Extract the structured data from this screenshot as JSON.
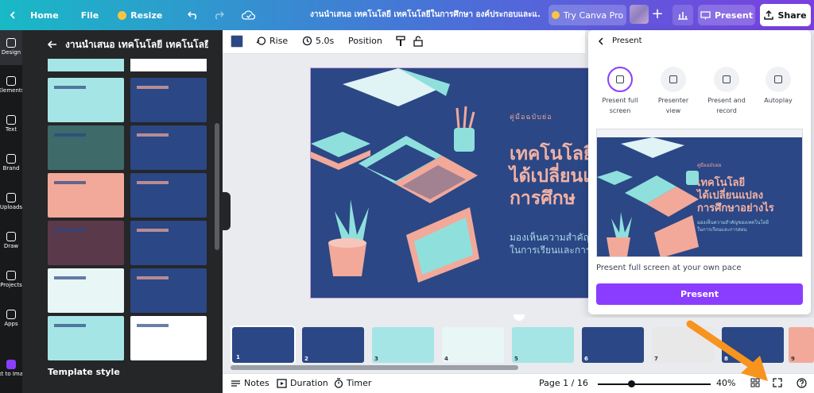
{
  "header": {
    "home_label": "Home",
    "file_label": "File",
    "resize_label": "Resize",
    "doc_title": "งานนำเสนอ เทคโนโลยี เทคโนโลยีในการศึกษา องค์ประกอบและแ...",
    "try_pro_label": "Try Canva Pro",
    "present_label": "Present",
    "share_label": "Share"
  },
  "rail": [
    {
      "label": "Design",
      "icon": "design-icon"
    },
    {
      "label": "Elements",
      "icon": "elements-icon"
    },
    {
      "label": "Text",
      "icon": "text-icon"
    },
    {
      "label": "Brand",
      "icon": "brand-icon"
    },
    {
      "label": "Uploads",
      "icon": "uploads-icon"
    },
    {
      "label": "Draw",
      "icon": "draw-icon"
    },
    {
      "label": "Projects",
      "icon": "projects-icon"
    },
    {
      "label": "Apps",
      "icon": "apps-icon"
    },
    {
      "label": "Text to Image",
      "icon": "text-to-image-icon"
    }
  ],
  "panel": {
    "title": "งานนำเสนอ เทคโนโลยี เทคโนโลยี",
    "template_style_label": "Template style"
  },
  "toolbar": {
    "color": "#2b4785",
    "rise_label": "Rise",
    "duration_label": "5.0s",
    "position_label": "Position"
  },
  "slide": {
    "subtitle": "คู่มือฉบับย่อ",
    "heading_lines": [
      "เทคโนโลยี",
      "ได้เปลี่ยนแ",
      "การศึกษ"
    ],
    "body_lines": [
      "มองเห็นความสำคัญ",
      "ในการเรียนและการส"
    ]
  },
  "present_panel": {
    "back_label": "Present",
    "options": [
      {
        "label": "Present full screen",
        "icon": "fullscreen-icon",
        "selected": true
      },
      {
        "label": "Presenter view",
        "icon": "presenter-view-icon",
        "selected": false
      },
      {
        "label": "Present and record",
        "icon": "record-icon",
        "selected": false
      },
      {
        "label": "Autoplay",
        "icon": "play-icon",
        "selected": false
      }
    ],
    "preview": {
      "subtitle": "คู่มือฉบับย่อ",
      "heading_lines": [
        "เทคโนโลยี",
        "ได้เปลี่ยนแปลง",
        "การศึกษาอย่างไร"
      ],
      "body_lines": [
        "มองเห็นความสำคัญของเทคโนโลยี",
        "ในการเรียนและการสอน"
      ]
    },
    "caption": "Present full screen at your own pace",
    "present_button": "Present"
  },
  "filmstrip": {
    "pages": [
      "1",
      "2",
      "3",
      "4",
      "5",
      "6",
      "7",
      "8",
      "9"
    ]
  },
  "bottom": {
    "notes_label": "Notes",
    "duration_label": "Duration",
    "timer_label": "Timer",
    "page_label": "Page 1 / 16",
    "zoom_label": "40%",
    "zoom_level_percent": 40
  },
  "colors": {
    "accent": "#8b3dff",
    "slide_bg": "#2b4785",
    "teal": "#8fe0dc",
    "salmon": "#f2a99a",
    "arrow": "#f7941d"
  }
}
